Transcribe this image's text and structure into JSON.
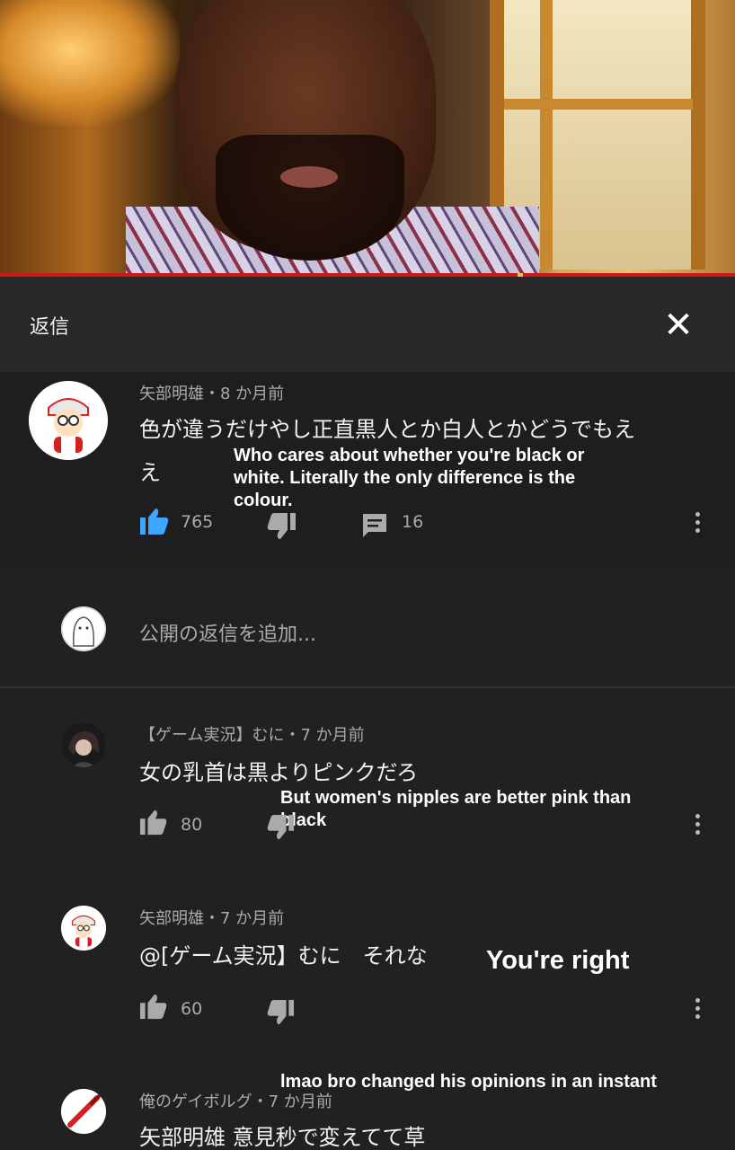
{
  "panel": {
    "title": "返信",
    "close_symbol": "✕"
  },
  "parent_comment": {
    "author_meta": "矢部明雄・8 か月前",
    "text_line1": "色が違うだけやし正直黒人とか白人とかどうでもえ",
    "text_line2": "え",
    "translation": [
      "Who cares about whether you're black or",
      "white. Literally the only difference is the",
      "colour."
    ],
    "likes": "765",
    "replies": "16"
  },
  "add_reply": {
    "placeholder": "公開の返信を追加..."
  },
  "replies": [
    {
      "author_meta": "【ゲーム実況】むに・7 か月前",
      "text": "女の乳首は黒よりピンクだろ",
      "translation": [
        "But women's nipples are better pink than",
        "black"
      ],
      "likes": "80"
    },
    {
      "author_meta": "矢部明雄・7 か月前",
      "text": "@[ゲーム実況】むに　それな",
      "translation": [
        "You're right"
      ],
      "likes": "60"
    },
    {
      "author_meta": "俺のゲイボルグ・7 か月前",
      "text": "矢部明雄 意見秒で変えてて草",
      "translation": [
        "lmao bro changed his opinions in an instant"
      ]
    }
  ],
  "colors": {
    "like_active": "#3ea6ff",
    "background": "#212121",
    "progress": "#cc1a1a"
  },
  "icons": [
    "thumbs-up-icon",
    "thumbs-down-icon",
    "comment-icon",
    "more-vert-icon",
    "close-icon"
  ]
}
